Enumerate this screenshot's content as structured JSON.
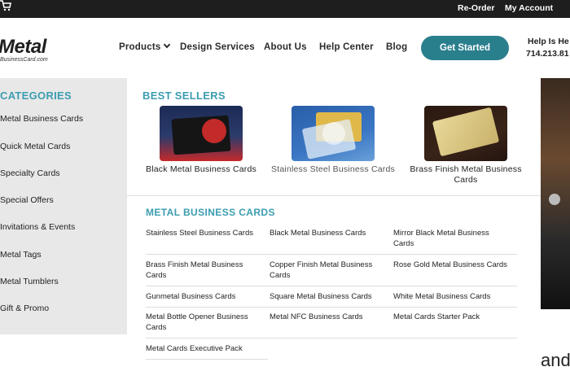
{
  "topbar": {
    "reorder": "Re-Order",
    "account": "My Account",
    "cart_icon": "cart-icon"
  },
  "header": {
    "logo_word": "Metal",
    "logo_sub": "BusinessCard.com",
    "nav": {
      "products": "Products",
      "design": "Design Services",
      "about": "About Us",
      "help": "Help Center",
      "blog": "Blog"
    },
    "cta": "Get Started",
    "help_top": "Help Is He",
    "help_phone": "714.213.81"
  },
  "categories": {
    "title": "CATEGORIES",
    "items": [
      "Metal Business Cards",
      "Quick Metal Cards",
      "Specialty Cards",
      "Special Offers",
      "Invitations & Events",
      "Metal Tags",
      "Metal Tumblers",
      "Gift & Promo"
    ]
  },
  "best_sellers": {
    "title": "BEST SELLERS",
    "items": [
      {
        "label": "Black Metal Business Cards"
      },
      {
        "label": "Stainless Steel Business Cards"
      },
      {
        "label": "Brass Finish Metal Business Cards"
      }
    ]
  },
  "metal_business_cards": {
    "title": "METAL BUSINESS CARDS",
    "links": [
      "Stainless Steel Business Cards",
      "Black Metal Business Cards",
      "Mirror Black Metal Business Cards",
      "Brass Finish Metal Business Cards",
      "Copper Finish Metal Business Cards",
      "Rose Gold Metal Business Cards",
      "Gunmetal Business Cards",
      "Square Metal Business Cards",
      "White Metal Business Cards",
      "Metal Bottle Opener Business Cards",
      "Metal NFC Business Cards",
      "Metal Cards Starter Pack",
      "Metal Cards Executive Pack"
    ]
  },
  "hero": {
    "text": "and"
  },
  "colors": {
    "accent": "#3b9db0",
    "cta": "#2a7f8d",
    "topbar": "#1e1e1e",
    "sidebar": "#e8e8e8"
  }
}
